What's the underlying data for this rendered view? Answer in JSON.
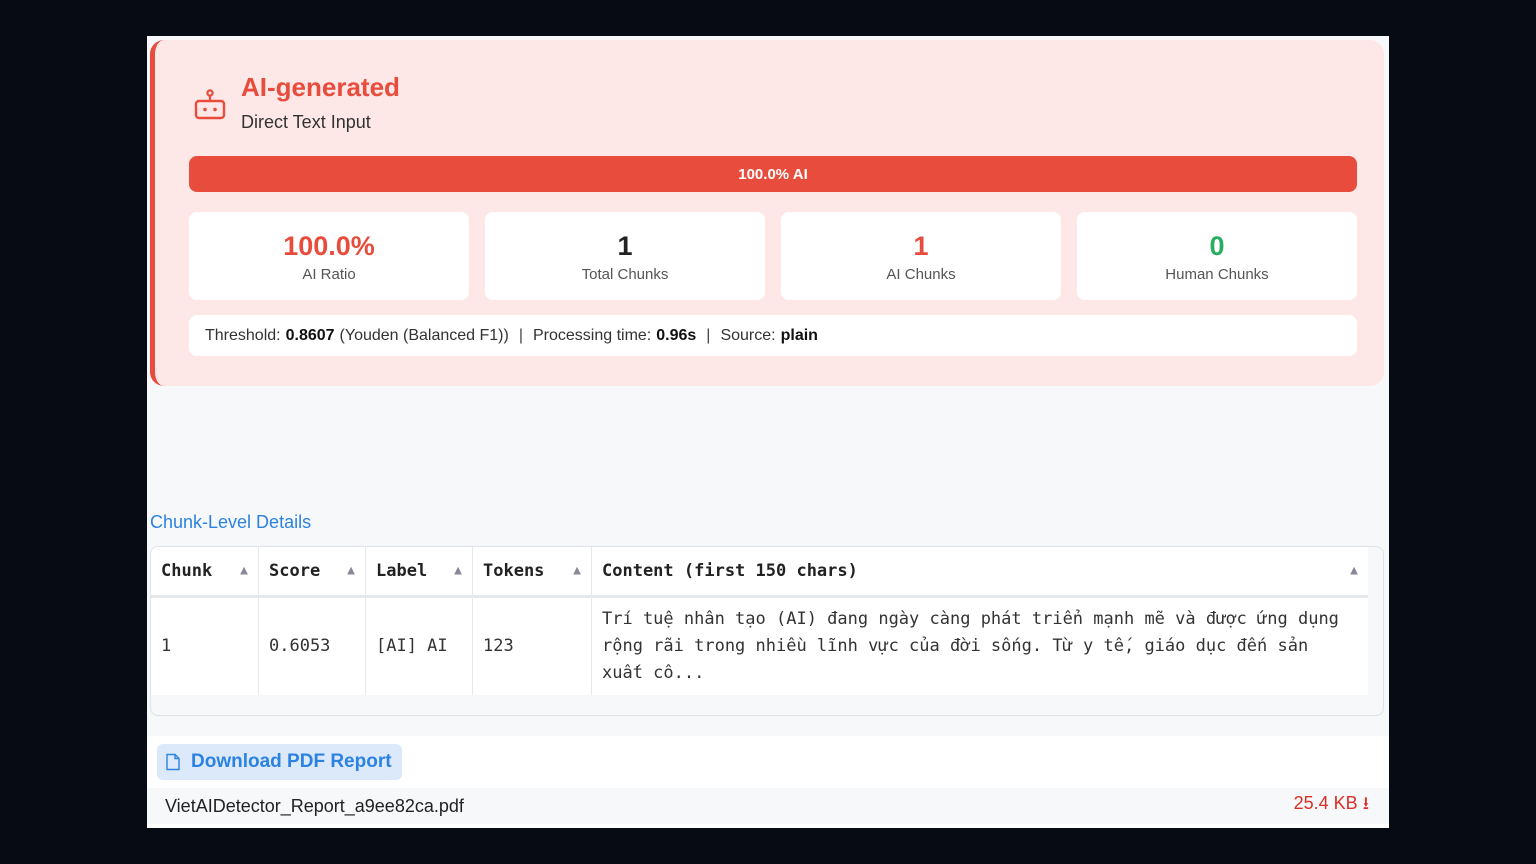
{
  "result": {
    "verdict": "AI-generated",
    "source_label": "Direct Text Input",
    "bar_label": "100.0% AI",
    "bar_fraction": 1.0,
    "colors": {
      "accent": "#e74c3c",
      "human": "#27ae60",
      "link": "#2c82e0"
    },
    "stats": [
      {
        "value": "100.0%",
        "label": "AI Ratio",
        "color": "#e74c3c"
      },
      {
        "value": "1",
        "label": "Total Chunks",
        "color": "#222222"
      },
      {
        "value": "1",
        "label": "AI Chunks",
        "color": "#e74c3c"
      },
      {
        "value": "0",
        "label": "Human Chunks",
        "color": "#27ae60"
      }
    ],
    "meta": {
      "threshold_label": "Threshold:",
      "threshold_value": "0.8607",
      "threshold_note": "(Youden (Balanced F1))",
      "time_label": "Processing time:",
      "time_value": "0.96s",
      "source_label": "Source:",
      "source_value": "plain",
      "separator": "|"
    }
  },
  "details": {
    "title": "Chunk-Level Details",
    "columns": [
      "Chunk",
      "Score",
      "Label",
      "Tokens",
      "Content (first 150 chars)"
    ],
    "sort_icon": "▲",
    "rows": [
      {
        "chunk": "1",
        "score": "0.6053",
        "label": "[AI] AI",
        "tokens": "123",
        "content": "Trí tuệ nhân tạo (AI) đang ngày càng phát triển mạnh mẽ và được ứng dụng rộng rãi trong nhiều lĩnh vực của đời sống. Từ y tế, giáo dục đến sản xuất cô..."
      }
    ]
  },
  "download": {
    "button_label": "Download PDF Report",
    "file_name": "VietAIDetector_Report_a9ee82ca.pdf",
    "file_size": "25.4 KB",
    "download_arrow": "⭳"
  }
}
